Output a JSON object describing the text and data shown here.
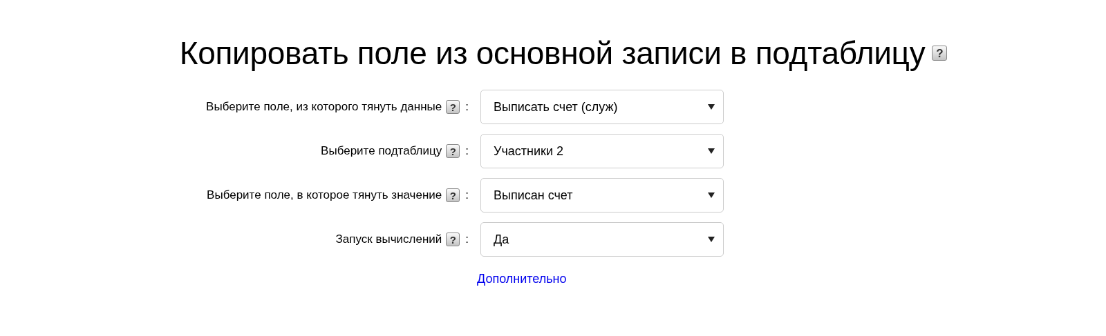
{
  "title": "Копировать поле из основной записи в подтаблицу",
  "title_help": "?",
  "fields": [
    {
      "label": "Выберите поле, из которого тянуть данные",
      "help": "?",
      "colon": ":",
      "value": "Выписать счет (служ)"
    },
    {
      "label": "Выберите подтаблицу",
      "help": "?",
      "colon": ":",
      "value": "Участники 2"
    },
    {
      "label": "Выберите поле, в которое тянуть значение",
      "help": "?",
      "colon": ":",
      "value": "Выписан счет"
    },
    {
      "label": "Запуск вычислений",
      "help": "?",
      "colon": ":",
      "value": "Да"
    }
  ],
  "link": "Дополнительно"
}
